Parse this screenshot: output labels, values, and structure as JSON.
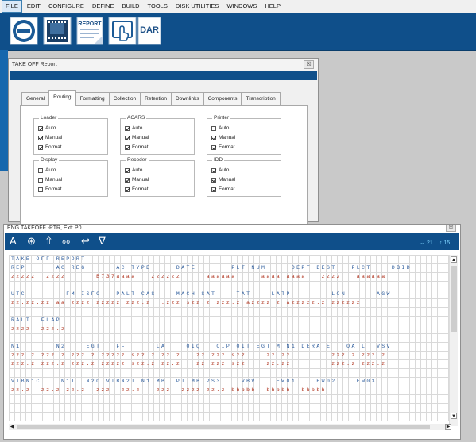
{
  "menu": [
    "FILE",
    "EDIT",
    "CONFIGURE",
    "DEFINE",
    "BUILD",
    "TOOLS",
    "DISK UTILITIES",
    "WINDOWS",
    "HELP"
  ],
  "toolbar": {
    "report_label": "REPORT",
    "dar_label": "DAR"
  },
  "takeoff_window": {
    "title": "TAKE OFF Report",
    "close_glyph": "☒",
    "tabs": [
      "General",
      "Routing",
      "Formatting",
      "Collection",
      "Retention",
      "Downlinks",
      "Components",
      "Transcription"
    ],
    "active_tab": "Routing",
    "groups": [
      {
        "title": "Loader",
        "options": [
          {
            "label": "Auto",
            "checked": true
          },
          {
            "label": "Manual",
            "checked": true
          },
          {
            "label": "Format",
            "checked": true
          }
        ]
      },
      {
        "title": "ACARS",
        "options": [
          {
            "label": "Auto",
            "checked": true
          },
          {
            "label": "Manual",
            "checked": true
          },
          {
            "label": "Format",
            "checked": true
          }
        ]
      },
      {
        "title": "Printer",
        "options": [
          {
            "label": "Auto",
            "checked": false
          },
          {
            "label": "Manual",
            "checked": true
          },
          {
            "label": "Format",
            "checked": true
          }
        ]
      },
      {
        "title": "Display",
        "options": [
          {
            "label": "Auto",
            "checked": false
          },
          {
            "label": "Manual",
            "checked": false
          },
          {
            "label": "Format",
            "checked": false
          }
        ]
      },
      {
        "title": "Recoder",
        "options": [
          {
            "label": "Auto",
            "checked": true
          },
          {
            "label": "Manual",
            "checked": true
          },
          {
            "label": "Format",
            "checked": true
          }
        ]
      },
      {
        "title": "IDD",
        "options": [
          {
            "label": "Auto",
            "checked": true
          },
          {
            "label": "Manual",
            "checked": true
          },
          {
            "label": "Format",
            "checked": true
          }
        ]
      }
    ]
  },
  "report_window": {
    "title": "ENG TAKEOFF -PTR, Ext: P0",
    "close_glyph": "☒",
    "icons": [
      "font-icon",
      "globe-icon",
      "upload-arrow-icon",
      "link-icon",
      "undo-arrow-icon",
      "filter-icon"
    ],
    "icon_glyphs": [
      "A",
      "⊛",
      "⇧",
      "ℴℴ",
      "↩",
      "∇"
    ],
    "width_indicator": "↔ 21",
    "height_indicator": "↕ 15",
    "lines": [
      {
        "kind": "label",
        "text": "TAKE OFF REPORT"
      },
      {
        "kind": "label",
        "text": "REP      AC REG      AC TYPE     DATE       FLT NUM     DEPT DEST   FLCT    DBID"
      },
      {
        "kind": "value",
        "text": "zzzzz  zzzz      B737aaaa   zzzzzz     aaaaaa     aaaa aaaa   zzzz   aaaaaa"
      },
      {
        "kind": "label",
        "text": ""
      },
      {
        "kind": "label",
        "text": "UTC        FM ISFC   PALT CAS    MACH SAT    TAT    LATP        LON      AGW"
      },
      {
        "kind": "value",
        "text": "zz.zz.zz aa zzzz zzzzz zzz.z  .zzz szz.z zzz.z azzzz.z azzzzz.z zzzzzz"
      },
      {
        "kind": "label",
        "text": ""
      },
      {
        "kind": "label",
        "text": "RALT  FLAP"
      },
      {
        "kind": "value",
        "text": "zzzz  zzz.z"
      },
      {
        "kind": "label",
        "text": ""
      },
      {
        "kind": "label",
        "text": "N1       N2    EGT   FF     TLA    OIQ   OIP OIT EGT M N1 DERATE   OATL  VSV"
      },
      {
        "kind": "value",
        "text": "zzz.z zzz.z zzz.z zzzzz szz.z zz.z   zz zzz szz    zz.zz        zzz.z zzz.z"
      },
      {
        "kind": "value",
        "text": "zzz.z zzz.z zzz.z zzzzz szz.z zz.z   zz zzz szz    zz.zz        zzz.z zzz.z"
      },
      {
        "kind": "label",
        "text": ""
      },
      {
        "kind": "label",
        "text": "VIBN1C    N1T  N2C VIBN2T N1IMB LPTIMB PS3    VBV    EW01    EW02    EW03"
      },
      {
        "kind": "value",
        "text": "zz.z  zz.z zz.z  zzz  zz.z   zzz  zzzz zz.z bbbbb  bbbbb  bbbbb"
      }
    ]
  }
}
